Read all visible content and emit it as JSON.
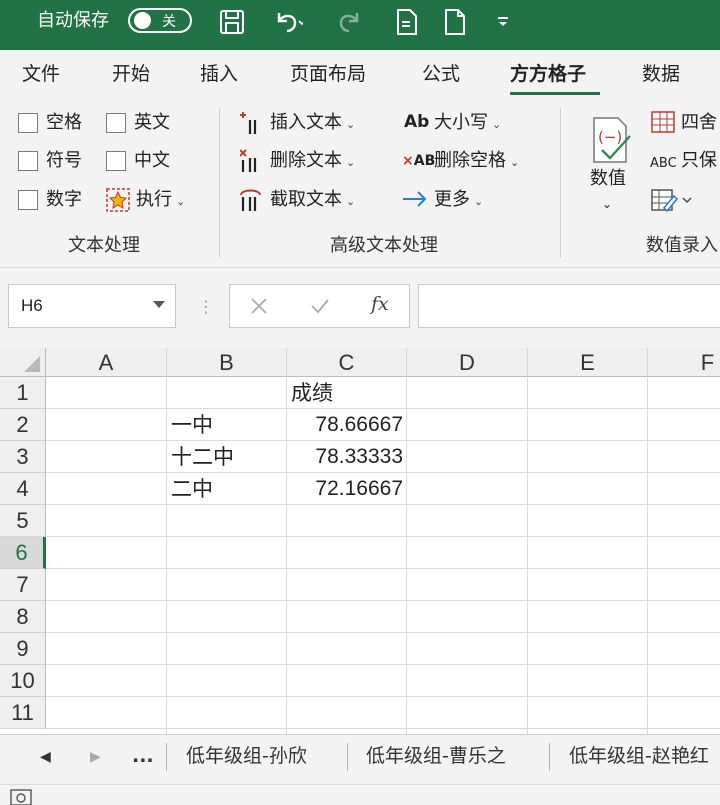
{
  "titlebar": {
    "autosave_label": "自动保存",
    "autosave_state": "关",
    "save_icon": "save-icon",
    "undo_icon": "undo-icon",
    "redo_icon": "redo-icon",
    "accent": "#217346"
  },
  "ribbon_tabs": [
    "文件",
    "开始",
    "插入",
    "页面布局",
    "公式",
    "方方格子",
    "数据"
  ],
  "active_tab": "方方格子",
  "ribbon": {
    "text_group": {
      "checkboxes": [
        "空格",
        "英文",
        "符号",
        "中文",
        "数字"
      ],
      "execute": "执行",
      "label": "文本处理"
    },
    "advanced_group": {
      "items": [
        "插入文本",
        "删除文本",
        "截取文本",
        "大小写",
        "删除空格",
        "更多"
      ],
      "label": "高级文本处理"
    },
    "numeric_group": {
      "value_button": "数值",
      "round": "四舍",
      "keep_only": "只保",
      "label": "数值录入"
    }
  },
  "formula_bar": {
    "name_box": "H6",
    "fx": "fx",
    "formula": ""
  },
  "grid": {
    "columns": [
      "A",
      "B",
      "C",
      "D",
      "E",
      "F"
    ],
    "rows": [
      "1",
      "2",
      "3",
      "4",
      "5",
      "6",
      "7",
      "8",
      "9",
      "10",
      "11"
    ],
    "active_row": "6",
    "cells": {
      "C1": "成绩",
      "B2": "一中",
      "C2": "78.66667",
      "B3": "十二中",
      "C3": "78.33333",
      "B4": "二中",
      "C4": "72.16667"
    }
  },
  "sheets": {
    "more": "...",
    "tabs": [
      "低年级组-孙欣",
      "低年级组-曹乐之",
      "低年级组-赵艳红"
    ]
  }
}
